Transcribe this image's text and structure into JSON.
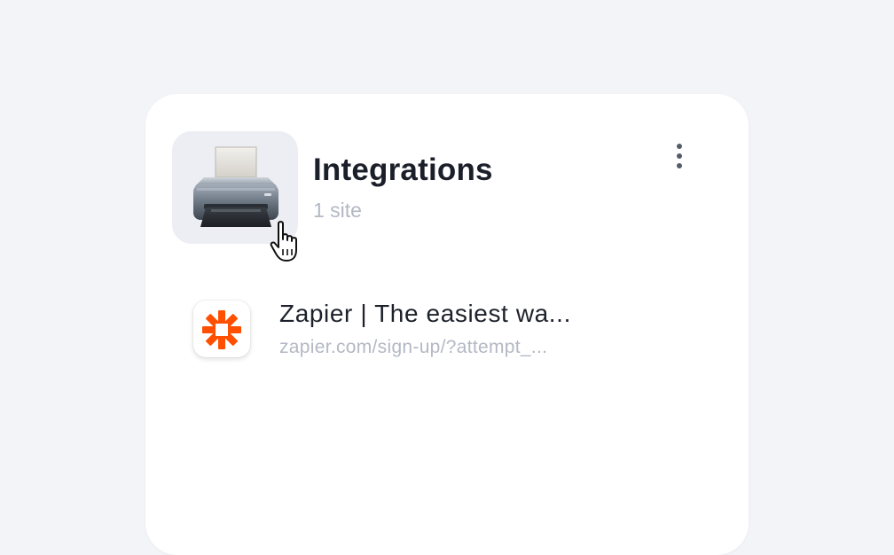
{
  "group": {
    "title": "Integrations",
    "count_label": "1 site",
    "icon": "printer-icon",
    "menu_icon": "more-vertical-icon"
  },
  "sites": [
    {
      "title": "Zapier | The easiest wa...",
      "url": "zapier.com/sign-up/?attempt_...",
      "favicon": "zapier-logo-icon",
      "brand_color": "#ff4f00"
    }
  ]
}
